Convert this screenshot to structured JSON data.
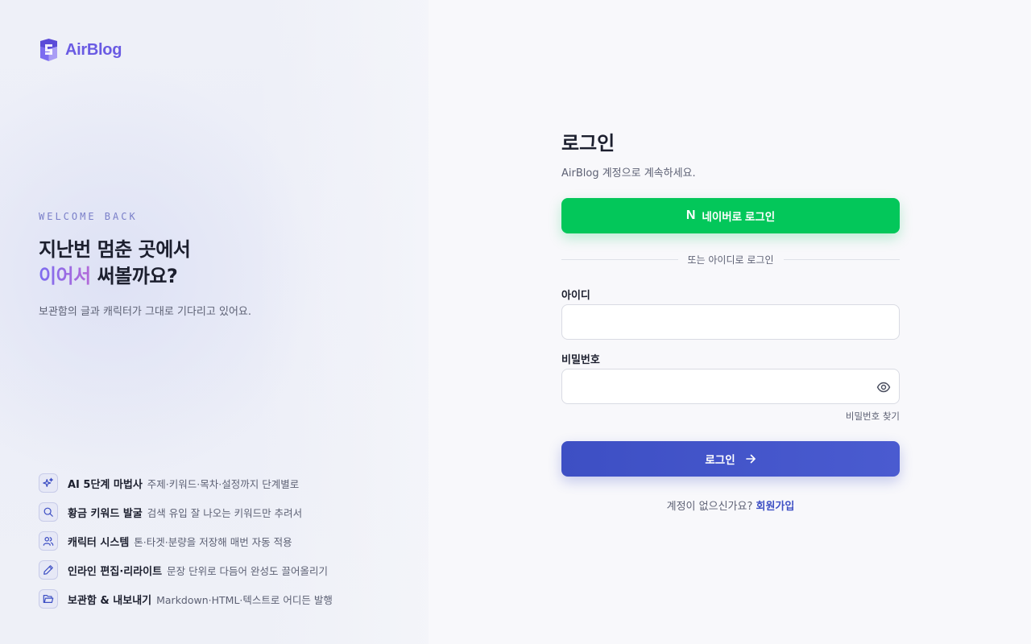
{
  "brand": {
    "name": "AirBlog",
    "accent": "#6a5be3"
  },
  "hero": {
    "eyebrow": "WELCOME BACK",
    "line1": "지난번 멈춘 곳에서",
    "line2_accent": "이어서",
    "line2_rest": " 써볼까요?",
    "subtitle": "보관함의 글과 캐릭터가 그대로 기다리고 있어요."
  },
  "features": [
    {
      "icon": "sparkles-icon",
      "title": "AI 5단계 마법사",
      "desc": "주제·키워드·목차·설정까지 단계별로"
    },
    {
      "icon": "search-icon",
      "title": "황금 키워드 발굴",
      "desc": "검색 유입 잘 나오는 키워드만 추려서"
    },
    {
      "icon": "users-icon",
      "title": "캐릭터 시스템",
      "desc": "톤·타겟·분량을 저장해 매번 자동 적용"
    },
    {
      "icon": "pencil-icon",
      "title": "인라인 편집·리라이트",
      "desc": "문장 단위로 다듬어 완성도 끌어올리기"
    },
    {
      "icon": "folder-icon",
      "title": "보관함 & 내보내기",
      "desc": "Markdown·HTML·텍스트로 어디든 발행"
    }
  ],
  "login": {
    "title": "로그인",
    "subtitle": "AirBlog 계정으로 계속하세요.",
    "naver_label": "네이버로 로그인",
    "naver_mark": "N",
    "naver_color": "#03c75a",
    "divider": "또는 아이디로 로그인",
    "id_label": "아이디",
    "id_value": "",
    "password_label": "비밀번호",
    "password_value": "",
    "find_password": "비밀번호 찾기",
    "submit_label": "로그인",
    "primary_color": "#3d4fc4",
    "signup_prompt": "계정이 없으신가요?",
    "signup_link": "회원가입"
  }
}
